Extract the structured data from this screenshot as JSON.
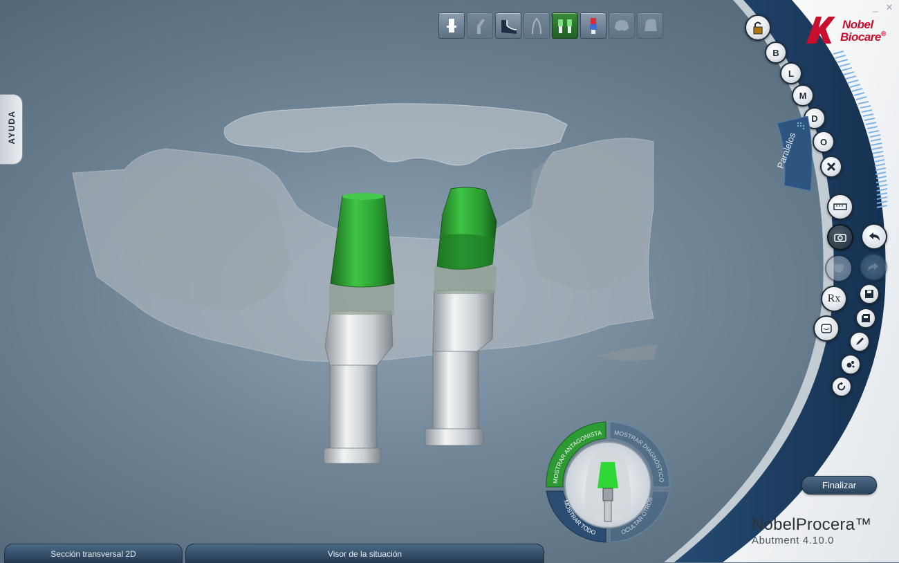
{
  "window_controls": {
    "minimize": "_",
    "close": "✕"
  },
  "help_tab": {
    "label": "AYUDA"
  },
  "toolbar": {
    "buttons": [
      {
        "icon": "implant-icon",
        "state": "normal"
      },
      {
        "icon": "angled-abutment-icon",
        "state": "dim"
      },
      {
        "icon": "abutment-profile-icon",
        "state": "normal"
      },
      {
        "icon": "tooth-outline-icon",
        "state": "dim"
      },
      {
        "icon": "double-abutment-icon",
        "state": "active"
      },
      {
        "icon": "abutment-color-icon",
        "state": "normal"
      },
      {
        "icon": "crown-icon",
        "state": "dim"
      },
      {
        "icon": "crown-angled-icon",
        "state": "dim"
      }
    ]
  },
  "brand": {
    "line1": "Nobel",
    "line2": "Biocare",
    "reg": "®"
  },
  "view_buttons": {
    "lock": "lock-icon",
    "b": "B",
    "l": "L",
    "m": "M",
    "d": "D",
    "o": "O",
    "reset": "reset-view-icon"
  },
  "paralelos": {
    "label": "Paralelos"
  },
  "tool_buttons": {
    "measure": "ruler-icon",
    "screenshot": "camera-icon",
    "tooth": "tooth-icon",
    "rx": "Rx",
    "case": "case-icon",
    "undo": "undo-icon",
    "redo": "redo-icon",
    "save": "save-icon",
    "save_as": "save-as-icon",
    "pen": "pen-icon",
    "dots": "points-icon",
    "refresh": "refresh-icon"
  },
  "view_selector": {
    "top_left": "MOSTRAR ANTAGONISTA",
    "top_right": "MOSTRAR DIAGNÓSTICO",
    "bottom_left": "MOSTRAR TODO",
    "bottom_right": "OCULTAR OTROS"
  },
  "finalize": {
    "label": "Finalizar"
  },
  "app": {
    "name": "NobelProcera™",
    "version": "Abutment 4.10.0"
  },
  "bottom_tabs": [
    {
      "label": "Sección transversal 2D"
    },
    {
      "label": "Visor de la situación"
    }
  ],
  "colors": {
    "accent_green": "#2f9b34",
    "panel_blue": "#1e3e63",
    "brand_red": "#c8102e"
  }
}
